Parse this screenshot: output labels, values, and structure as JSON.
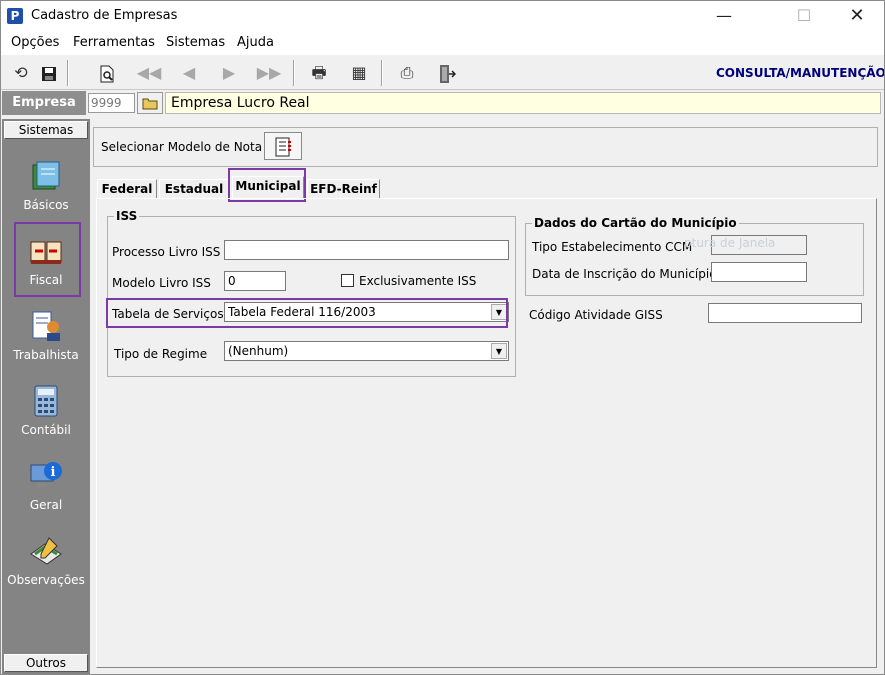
{
  "window": {
    "title": "Cadastro de Empresas",
    "app_icon": "P"
  },
  "window_controls": {
    "minimize": "—",
    "maximize": "☐",
    "close": "✕"
  },
  "menu": {
    "items": [
      "Opções",
      "Ferramentas",
      "Sistemas",
      "Ajuda"
    ]
  },
  "toolbar": {
    "mode_label": "CONSULTA/MANUTENÇÃO",
    "icons": [
      "undo-icon",
      "save-icon",
      "search-document-icon",
      "first-record-icon",
      "previous-record-icon",
      "next-record-icon",
      "last-record-icon",
      "print-icon",
      "calculator-icon",
      "printer-settings-icon",
      "exit-door-icon"
    ]
  },
  "empresa": {
    "label": "Empresa",
    "code": "9999",
    "name": "Empresa Lucro Real"
  },
  "sidebar": {
    "header": "Sistemas",
    "footer": "Outros",
    "items": [
      {
        "label": "Básicos",
        "icon": "book-stack-icon"
      },
      {
        "label": "Fiscal",
        "icon": "open-book-icon"
      },
      {
        "label": "Trabalhista",
        "icon": "worker-document-icon"
      },
      {
        "label": "Contábil",
        "icon": "calculator-icon"
      },
      {
        "label": "Geral",
        "icon": "info-monitor-icon"
      },
      {
        "label": "Observações",
        "icon": "notes-pencil-icon"
      }
    ],
    "highlighted": "Fiscal"
  },
  "model": {
    "label": "Selecionar Modelo de Nota",
    "icon": "note-list-icon"
  },
  "tabs": {
    "items": [
      "Federal",
      "Estadual",
      "Municipal",
      "EFD-Reinf"
    ],
    "active": "Municipal"
  },
  "iss": {
    "legend": "ISS",
    "processo_livro_label": "Processo Livro ISS",
    "processo_livro_value": "",
    "modelo_livro_label": "Modelo Livro ISS",
    "modelo_livro_value": "0",
    "exclusivamente_label": "Exclusivamente ISS",
    "tabela_servicos_label": "Tabela de Serviços",
    "tabela_servicos_value": "Tabela Federal 116/2003",
    "tipo_regime_label": "Tipo de Regime",
    "tipo_regime_value": "(Nenhum)"
  },
  "cartao": {
    "legend": "Dados do Cartão do Município",
    "tipo_estab_label": "Tipo Estabelecimento CCM",
    "tipo_estab_value": "",
    "data_inscricao_label": "Data de Inscrição do Município",
    "data_inscricao_value": "",
    "ghost_text": "ptura de Janela"
  },
  "giss": {
    "label": "Código Atividade GISS",
    "value": ""
  },
  "colors": {
    "highlight": "#7a3aa8",
    "sidebar": "#848484",
    "empresa_field": "#ffffe1",
    "mode_label": "#00007a"
  }
}
